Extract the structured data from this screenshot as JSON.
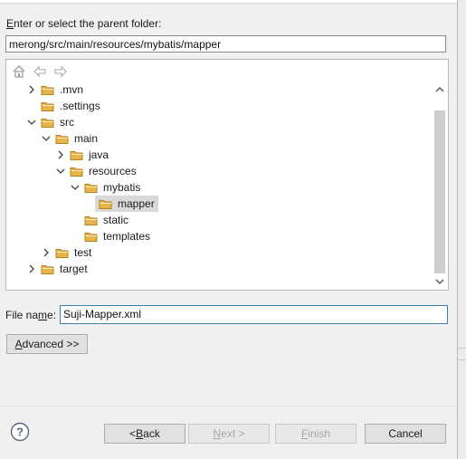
{
  "parent_folder": {
    "label": "Enter or select the parent folder:",
    "path_value": "merong/src/main/resources/mybatis/mapper"
  },
  "tree": {
    "toolbar": [
      {
        "name": "home-icon"
      },
      {
        "name": "back-arrow-icon"
      },
      {
        "name": "forward-arrow-icon"
      }
    ],
    "items": [
      {
        "label": ".mvn",
        "depth": 0,
        "expander": "collapsed"
      },
      {
        "label": ".settings",
        "depth": 0,
        "expander": "none"
      },
      {
        "label": "src",
        "depth": 0,
        "expander": "expanded"
      },
      {
        "label": "main",
        "depth": 1,
        "expander": "expanded"
      },
      {
        "label": "java",
        "depth": 2,
        "expander": "collapsed"
      },
      {
        "label": "resources",
        "depth": 2,
        "expander": "expanded"
      },
      {
        "label": "mybatis",
        "depth": 3,
        "expander": "expanded"
      },
      {
        "label": "mapper",
        "depth": 4,
        "expander": "none",
        "selected": true
      },
      {
        "label": "static",
        "depth": 3,
        "expander": "none"
      },
      {
        "label": "templates",
        "depth": 3,
        "expander": "none"
      },
      {
        "label": "test",
        "depth": 1,
        "expander": "collapsed"
      },
      {
        "label": "target",
        "depth": 0,
        "expander": "collapsed"
      }
    ]
  },
  "file_name": {
    "label": "File name:",
    "value": "Suji-Mapper.xml"
  },
  "buttons": {
    "advanced": "Advanced >>",
    "back": "< Back",
    "next": "Next >",
    "finish": "Finish",
    "cancel": "Cancel"
  },
  "colors": {
    "folder": "#e9b54a",
    "selection": "#d9d9d9",
    "focus_border": "#3c7fb1"
  }
}
